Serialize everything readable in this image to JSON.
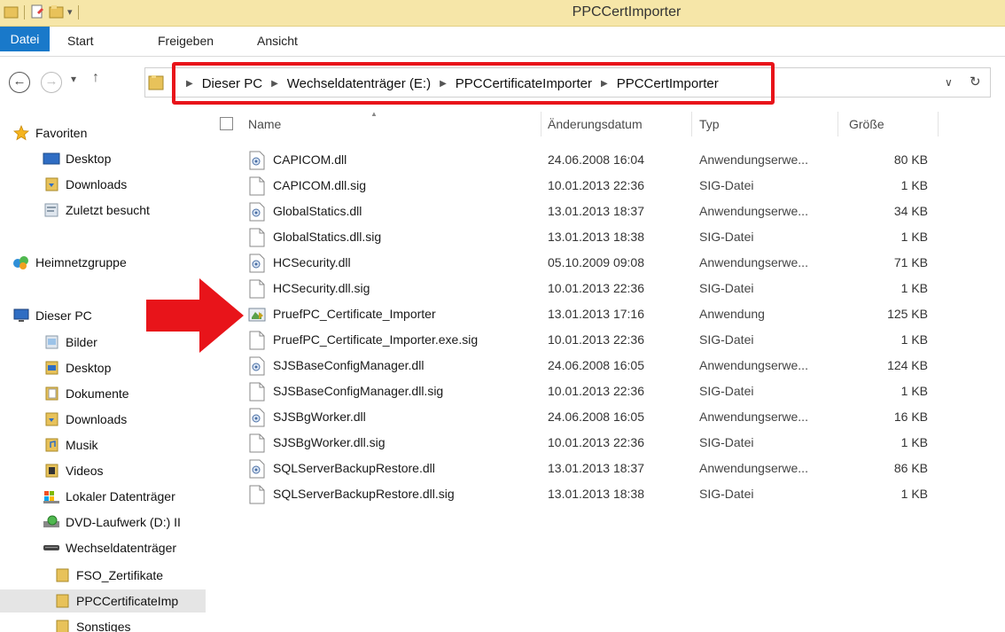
{
  "window": {
    "title": "PPCCertImporter"
  },
  "ribbon": {
    "tabs": [
      "Datei",
      "Start",
      "Freigeben",
      "Ansicht"
    ]
  },
  "address": {
    "crumbs": [
      "Dieser PC",
      "Wechseldatenträger (E:)",
      "PPCCertificateImporter",
      "PPCCertImporter"
    ],
    "highlight_color": "#e8141a"
  },
  "nav": {
    "favorites_label": "Favoriten",
    "favorites": [
      "Desktop",
      "Downloads",
      "Zuletzt besucht"
    ],
    "homegroup_label": "Heimnetzgruppe",
    "thispc_label": "Dieser PC",
    "thispc_items": [
      "Bilder",
      "Desktop",
      "Dokumente",
      "Downloads",
      "Musik",
      "Videos",
      "Lokaler Datenträger",
      "DVD-Laufwerk (D:) II",
      "Wechseldatenträger"
    ],
    "drive_children": [
      "FSO_Zertifikate",
      "PPCCertificateImp",
      "Sonstiges"
    ]
  },
  "columns": {
    "name": "Name",
    "date": "Änderungsdatum",
    "type": "Typ",
    "size": "Größe"
  },
  "files": [
    {
      "name": "CAPICOM.dll",
      "date": "24.06.2008 16:04",
      "type": "Anwendungserwe...",
      "size": "80 KB",
      "icon": "dll-icon"
    },
    {
      "name": "CAPICOM.dll.sig",
      "date": "10.01.2013 22:36",
      "type": "SIG-Datei",
      "size": "1 KB",
      "icon": "file-icon"
    },
    {
      "name": "GlobalStatics.dll",
      "date": "13.01.2013 18:37",
      "type": "Anwendungserwe...",
      "size": "34 KB",
      "icon": "dll-icon"
    },
    {
      "name": "GlobalStatics.dll.sig",
      "date": "13.01.2013 18:38",
      "type": "SIG-Datei",
      "size": "1 KB",
      "icon": "file-icon"
    },
    {
      "name": "HCSecurity.dll",
      "date": "05.10.2009 09:08",
      "type": "Anwendungserwe...",
      "size": "71 KB",
      "icon": "dll-icon"
    },
    {
      "name": "HCSecurity.dll.sig",
      "date": "10.01.2013 22:36",
      "type": "SIG-Datei",
      "size": "1 KB",
      "icon": "file-icon"
    },
    {
      "name": "PruefPC_Certificate_Importer",
      "date": "13.01.2013 17:16",
      "type": "Anwendung",
      "size": "125 KB",
      "icon": "exe-icon"
    },
    {
      "name": "PruefPC_Certificate_Importer.exe.sig",
      "date": "10.01.2013 22:36",
      "type": "SIG-Datei",
      "size": "1 KB",
      "icon": "file-icon"
    },
    {
      "name": "SJSBaseConfigManager.dll",
      "date": "24.06.2008 16:05",
      "type": "Anwendungserwe...",
      "size": "124 KB",
      "icon": "dll-icon"
    },
    {
      "name": "SJSBaseConfigManager.dll.sig",
      "date": "10.01.2013 22:36",
      "type": "SIG-Datei",
      "size": "1 KB",
      "icon": "file-icon"
    },
    {
      "name": "SJSBgWorker.dll",
      "date": "24.06.2008 16:05",
      "type": "Anwendungserwe...",
      "size": "16 KB",
      "icon": "dll-icon"
    },
    {
      "name": "SJSBgWorker.dll.sig",
      "date": "10.01.2013 22:36",
      "type": "SIG-Datei",
      "size": "1 KB",
      "icon": "file-icon"
    },
    {
      "name": "SQLServerBackupRestore.dll",
      "date": "13.01.2013 18:37",
      "type": "Anwendungserwe...",
      "size": "86 KB",
      "icon": "dll-icon"
    },
    {
      "name": "SQLServerBackupRestore.dll.sig",
      "date": "13.01.2013 18:38",
      "type": "SIG-Datei",
      "size": "1 KB",
      "icon": "file-icon"
    }
  ],
  "annotation": {
    "arrow_color": "#e8141a",
    "target": "PruefPC_Certificate_Importer"
  }
}
